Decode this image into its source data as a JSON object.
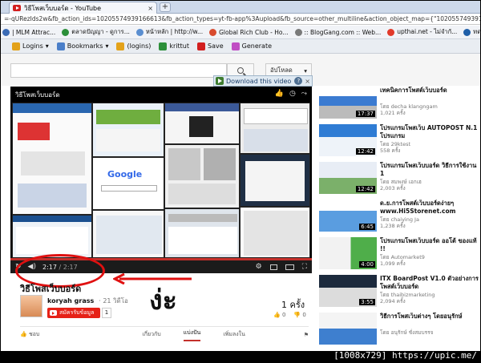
{
  "browser": {
    "tab_title": "วิธีโพสเว็บบอร์ด - YouTube",
    "tab_close": "×",
    "newtab": "+",
    "url": "=-qURezIds2w&fb_action_ids=10205574939166613&fb_action_types=yt-fb-app%3Aupload&fb_source=other_multiline&action_object_map={\"10205574939166613\"%3A465905033464837}&acti",
    "bookmarks": [
      {
        "label": "| MLM Attrac...",
        "color": "#3b6bb5"
      },
      {
        "label": "ตลาดปัญญา - ดูการ...",
        "color": "#2c8f3a"
      },
      {
        "label": "หน้าหลัก | http://w...",
        "color": "#5a8ed0"
      },
      {
        "label": "Global Rich Club - Ho...",
        "color": "#d84b2e"
      },
      {
        "label": ":: BlogGang.com :: Web...",
        "color": "#7a7a7a"
      },
      {
        "label": "upthai.net - ไม่จำกั...",
        "color": "#e23a2a"
      },
      {
        "label": "ทดสอบ CODE HTML",
        "color": "#1f5fa8"
      }
    ],
    "bookmarks2": [
      {
        "label": "Logins",
        "arrow": "▾",
        "color": "#e3a21a"
      },
      {
        "label": "Bookmarks",
        "arrow": "▾",
        "color": "#4a7fc9"
      },
      {
        "label": "(logins)",
        "arrow": "",
        "color": "#e3a21a"
      },
      {
        "label": "krittut",
        "arrow": "",
        "color": "#2c8f3a"
      },
      {
        "label": "Save",
        "arrow": "",
        "color": "#d21f1f"
      },
      {
        "label": "Generate",
        "arrow": "",
        "color": "#c04ec4"
      }
    ]
  },
  "youtube": {
    "upload_label": "อัปโหลด",
    "upload_arrow": "▾",
    "download_label": "Download this video",
    "download_help": "?",
    "download_close": "×"
  },
  "player": {
    "title": "วิธีโพสเว็บบอร์ด",
    "current_time": "2:17",
    "duration": "/ 2:17"
  },
  "annotation": {
    "thai_text": "ง่ะ"
  },
  "video": {
    "title": "วิธีโพสเว็บบอร์ด",
    "uploader": "koryah grass",
    "uploader_meta": "· 21 วิดีโอ",
    "subscribe_label": "สมัครรับข้อมูล",
    "subscriber_count": "1",
    "views": "1 ครั้ง",
    "likes": "0",
    "dislikes": "0",
    "actions": [
      "ชอบ",
      "เกี่ยวกับ",
      "แบ่งปัน",
      "เพิ่มลงใน"
    ]
  },
  "related": [
    {
      "title": "เทคนิคการโพสต์เว็บบอร์ด",
      "by": "โดย decha klangngam",
      "views": "1,021 ครั้ง",
      "duration": "17:37"
    },
    {
      "title": "โปรแกรมโพสเว็บ AUTOPOST N.1 โปรแกรม",
      "by": "โดย 29ktest",
      "views": "558 ครั้ง",
      "duration": "12:42"
    },
    {
      "title": "โปรแกรมโพสเว็บบอร์ด วิธีการใช้งาน 1",
      "by": "โดย สมพงษ์ เอกเฮ",
      "views": "2,003 ครั้ง",
      "duration": "12:42"
    },
    {
      "title": "ด.ย.การโพสต์เว็บบอร์ดง่ายๆ www.Hi5Storenet.com",
      "by": "โดย chaiying Ja",
      "views": "1,238 ครั้ง",
      "duration": "6:45"
    },
    {
      "title": "โปรแกรมโพสเว็บบอร์ด ออโต้ ของแท้ !!",
      "by": "โดย Automarket9",
      "views": "1,099 ครั้ง",
      "duration": "4:00"
    },
    {
      "title": "ITX BoardPost V1.0 ตัวอย่างการโพสต์เว็บบอร์ด",
      "by": "โดย thaibizmarketing",
      "views": "2,094 ครั้ง",
      "duration": "3:55"
    },
    {
      "title": "วิธีการโพสเว็บต่างๆ โดยอนุรักษ์",
      "by": "โดย อนุรักษ์ ชั่งสมบรรจ",
      "views": "",
      "duration": ""
    }
  ],
  "watermark": "[1008x729] https://upic.me/"
}
